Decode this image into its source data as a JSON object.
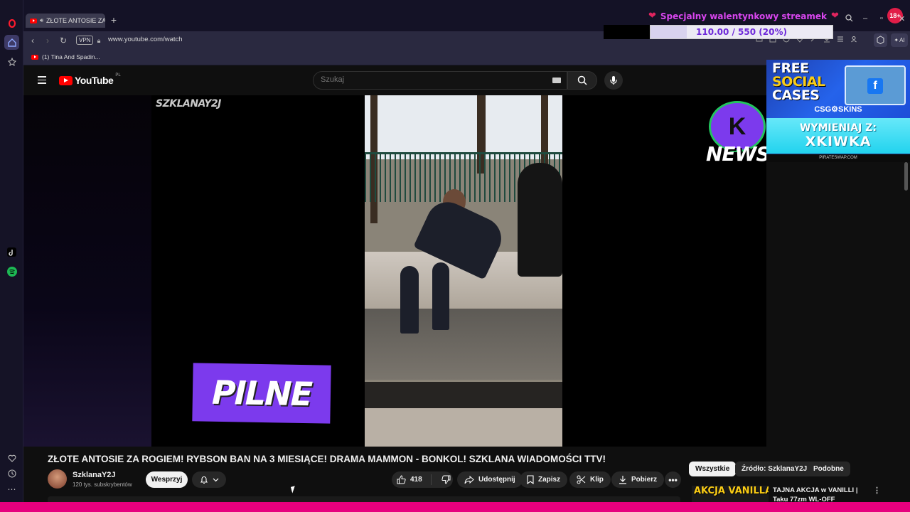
{
  "browser": {
    "tab_title": "ZŁOTE ANTOSIE ZA R",
    "new_tab_symbol": "+",
    "vpn_label": "VPN",
    "url": "www.youtube.com/watch",
    "bookmark_label": "(1) Tina And Spadin...",
    "ai_label": "AI"
  },
  "stream_overlay": {
    "title": "Specjalny walentynkowy streamek",
    "goal_text": "110.00 / 550 (20%)",
    "goal_fraction": 0.2,
    "age_badge": "18+"
  },
  "youtube": {
    "logo_text": "YouTube",
    "country_code": "PL",
    "search_placeholder": "Szukaj"
  },
  "video": {
    "watermark": "SZKLANAY2J",
    "overlay_pilne": "PILNE",
    "news_logo_text": "NEWS",
    "title": "ZŁOTE ANTOSIE ZA ROGIEM! RYBSON BAN NA 3 MIESIĄCE! DRAMA MAMMON - BONKOL! SZKLANA WIADOMOŚCI TTV!"
  },
  "ad": {
    "line1": "FREE",
    "line2": "SOCIAL",
    "line3": "CASES",
    "brand": "CSG⚙SKINS",
    "swap_text": "WYMIENIAJ Z:",
    "code": "XKIWKA",
    "site": "PIRATESWAP.COM"
  },
  "channel": {
    "name": "SzklanaY2J",
    "subscribers": "120 tys. subskrybentów",
    "support_label": "Wesprzyj"
  },
  "actions": {
    "like_count": "418",
    "share_label": "Udostępnij",
    "save_label": "Zapisz",
    "clip_label": "Klip",
    "download_label": "Pobierz"
  },
  "chips": {
    "all": "Wszystkie",
    "source": "Źródło: SzklanaY2J",
    "related": "Podobne"
  },
  "suggestion": {
    "thumb_text": "AKCJA VANILLA",
    "title": "TAJNA AKCJA w VANILLI | Taku 77zm WL-OFF"
  },
  "colors": {
    "accent_purple": "#7c3aed",
    "yt_red": "#ff0000",
    "stream_pink": "#d946ef",
    "bottom_strip": "#e6007e"
  }
}
